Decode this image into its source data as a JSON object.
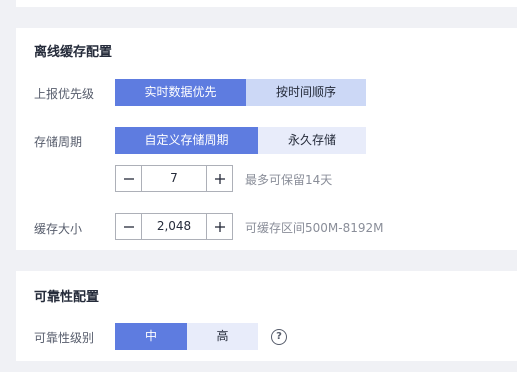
{
  "offline_cache": {
    "title": "离线缓存配置",
    "report_priority": {
      "label": "上报优先级",
      "options": [
        "实时数据优先",
        "按时间顺序"
      ],
      "selected": "实时数据优先"
    },
    "storage_period": {
      "label": "存储周期",
      "options": [
        "自定义存储周期",
        "永久存储"
      ],
      "selected": "自定义存储周期",
      "value": "7",
      "hint": "最多可保留14天"
    },
    "cache_size": {
      "label": "缓存大小",
      "value": "2,048",
      "hint": "可缓存区间500M-8192M"
    }
  },
  "reliability": {
    "title": "可靠性配置",
    "level": {
      "label": "可靠性级别",
      "options": [
        "中",
        "高"
      ],
      "selected": "中",
      "help_icon": "question-circle-icon"
    }
  },
  "colors": {
    "accent": "#5e7ce0",
    "inactive_bg": "#e8ecfa",
    "page_bg": "#f0f1f5"
  }
}
